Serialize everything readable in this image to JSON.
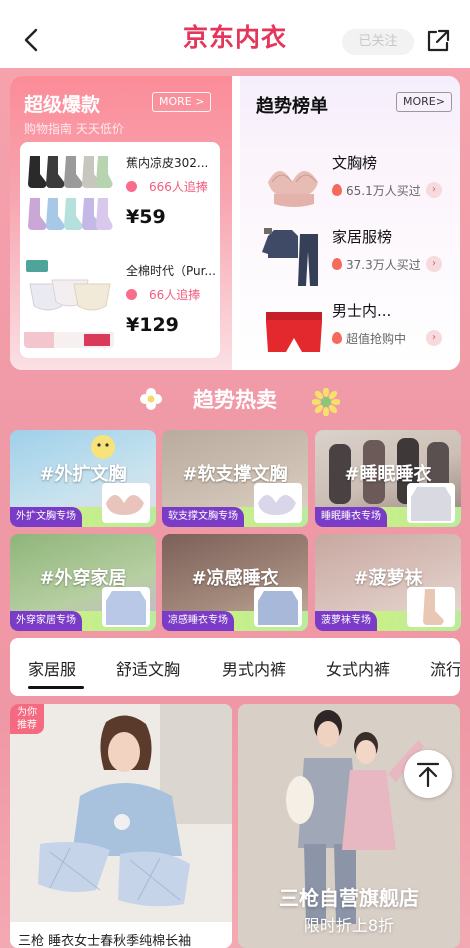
{
  "header": {
    "brand": "京东内衣",
    "follow_label": "已关注"
  },
  "hot": {
    "title": "超级爆款",
    "subtitle": "购物指南 天天低价",
    "more_label": "MORE >",
    "items": [
      {
        "name": "蕉内凉皮302...",
        "chase": "666人追捧",
        "price": "¥59"
      },
      {
        "name": "全棉时代（Pur...",
        "chase": "66人追捧",
        "price": "¥129"
      }
    ]
  },
  "trend": {
    "title": "趋势榜单",
    "more_label": "MORE>",
    "items": [
      {
        "name": "文胸榜",
        "meta": "65.1万人买过"
      },
      {
        "name": "家居服榜",
        "meta": "37.3万人买过"
      },
      {
        "name": "男士内...",
        "meta": "超值抢购中"
      }
    ]
  },
  "hot_sale": {
    "title": "趋势热卖",
    "tiles": [
      {
        "tag": "#外扩文胸",
        "foot": "外扩文胸专场"
      },
      {
        "tag": "#软支撑文胸",
        "foot": "软支撑文胸专场"
      },
      {
        "tag": "#睡眠睡衣",
        "foot": "睡眠睡衣专场"
      },
      {
        "tag": "#外穿家居",
        "foot": "外穿家居专场"
      },
      {
        "tag": "#凉感睡衣",
        "foot": "凉感睡衣专场"
      },
      {
        "tag": "#菠萝袜",
        "foot": "菠萝袜专场"
      }
    ]
  },
  "tabs": [
    "家居服",
    "舒适文胸",
    "男式内裤",
    "女式内裤",
    "流行"
  ],
  "products": {
    "left": {
      "badge_line1": "为你",
      "badge_line2": "推荐",
      "title": "三枪 睡衣女士春秋季纯棉长袖"
    },
    "right": {
      "title": "三枪自营旗舰店",
      "subtitle": "限时折上8折"
    }
  },
  "colors": {
    "brand": "#e4365a",
    "page_bg": "#f19aa7",
    "chase": "#f25c7d"
  }
}
